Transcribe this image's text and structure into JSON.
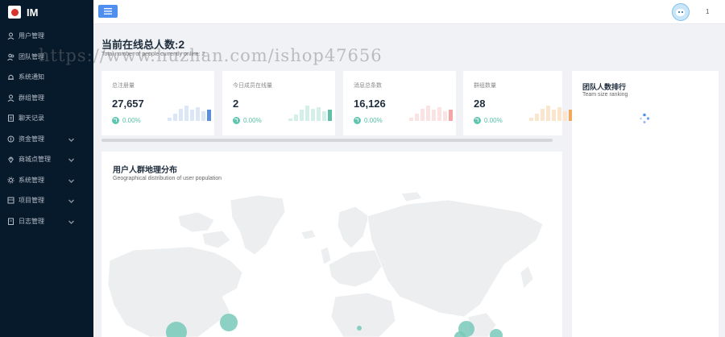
{
  "app": {
    "name": "IM"
  },
  "sidebar": {
    "items": [
      {
        "label": "用户管理",
        "icon": "user-icon",
        "expandable": false
      },
      {
        "label": "团队管理",
        "icon": "team-icon",
        "expandable": false
      },
      {
        "label": "系统通知",
        "icon": "bell-icon",
        "expandable": false
      },
      {
        "label": "群组管理",
        "icon": "group-icon",
        "expandable": false
      },
      {
        "label": "聊天记录",
        "icon": "document-icon",
        "expandable": false
      },
      {
        "label": "资金管理",
        "icon": "money-icon",
        "expandable": true
      },
      {
        "label": "商城点管理",
        "icon": "location-icon",
        "expandable": true
      },
      {
        "label": "系统管理",
        "icon": "gear-icon",
        "expandable": true
      },
      {
        "label": "项目管理",
        "icon": "project-icon",
        "expandable": true
      },
      {
        "label": "日志管理",
        "icon": "log-icon",
        "expandable": true
      }
    ]
  },
  "header": {
    "count": "1"
  },
  "online": {
    "title": "当前在线总人数:",
    "value": "2",
    "subtitle": "Total number of people currently online: 2"
  },
  "stats": [
    {
      "label": "总注册量",
      "value": "27,657",
      "pct": "0.00%",
      "color": "#5b8fd9",
      "light": "#dbe7f7",
      "bars": [
        0.2,
        0.45,
        0.75,
        0.95,
        0.7,
        0.85,
        0.6,
        0.7
      ]
    },
    {
      "label": "今日成员在线量",
      "value": "2",
      "pct": "0.00%",
      "color": "#5fbfa9",
      "light": "#d4eee8",
      "bars": [
        0.15,
        0.4,
        0.7,
        0.95,
        0.75,
        0.85,
        0.6,
        0.7
      ]
    },
    {
      "label": "消息总条数",
      "value": "16,126",
      "pct": "0.00%",
      "color": "#f2a6a6",
      "light": "#fbe3e3",
      "bars": [
        0.2,
        0.45,
        0.75,
        0.95,
        0.7,
        0.85,
        0.6,
        0.7
      ]
    },
    {
      "label": "群组数量",
      "value": "28",
      "pct": "0.00%",
      "color": "#f0a85a",
      "light": "#fbe6cd",
      "bars": [
        0.2,
        0.45,
        0.75,
        0.95,
        0.7,
        0.85,
        0.6,
        0.7
      ]
    }
  ],
  "map": {
    "title": "用户人群地理分布",
    "subtitle": "Geographical distribution of user population",
    "marker_color": "#78c9b8"
  },
  "team": {
    "title": "团队人数排行",
    "subtitle": "Team size ranking"
  },
  "watermark": "https://www.huzhan.com/ishop47656"
}
